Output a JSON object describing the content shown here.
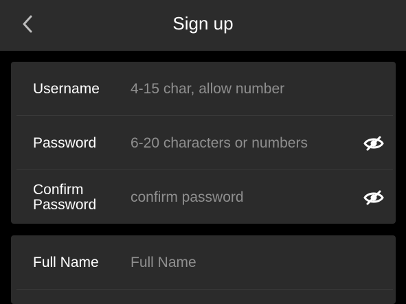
{
  "header": {
    "title": "Sign up",
    "back_icon": "chevron-left-icon"
  },
  "form": {
    "username": {
      "label": "Username",
      "placeholder": "4-15 char, allow number",
      "value": ""
    },
    "password": {
      "label": "Password",
      "placeholder": "6-20 characters or numbers",
      "value": "",
      "toggle_icon": "eye-off-icon"
    },
    "confirm_password": {
      "label_line1": "Confirm",
      "label_line2": "Password",
      "placeholder": "confirm password",
      "value": "",
      "toggle_icon": "eye-off-icon"
    },
    "full_name": {
      "label": "Full Name",
      "placeholder": "Full Name",
      "value": ""
    }
  },
  "colors": {
    "background": "#000000",
    "header_bg": "#2c2c2c",
    "card_bg": "#2b2b2b",
    "text": "#ffffff",
    "placeholder": "#8f8f8f",
    "divider": "#3a3a3a"
  }
}
